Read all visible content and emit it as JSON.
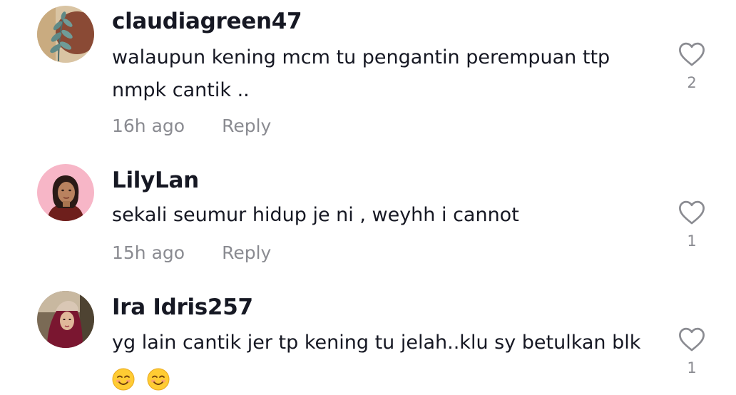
{
  "comments": [
    {
      "username": "claudiagreen47",
      "text_line1": "walaupun kening mcm tu pengantin perempuan ttp",
      "text_line2": "nmpk cantik ..",
      "time": "16h ago",
      "reply_label": "Reply",
      "likes": "2",
      "avatar_icon": "plant-leaf-avatar"
    },
    {
      "username": "LilyLan",
      "text_line1": "sekali seumur hidup je ni , weyhh i cannot",
      "time": "15h ago",
      "reply_label": "Reply",
      "likes": "1",
      "avatar_icon": "girl-portrait-avatar"
    },
    {
      "username": "Ira Idris257",
      "text_line1": "yg lain cantik jer tp kening tu jelah..klu sy betulkan blk",
      "emojis": [
        "smiling-face-emoji",
        "smiling-face-emoji"
      ],
      "likes": "1",
      "avatar_icon": "hijab-portrait-avatar"
    }
  ],
  "colors": {
    "text": "#161823",
    "secondary": "#8a8b91",
    "avatar2_bg": "#f7b6c7"
  }
}
